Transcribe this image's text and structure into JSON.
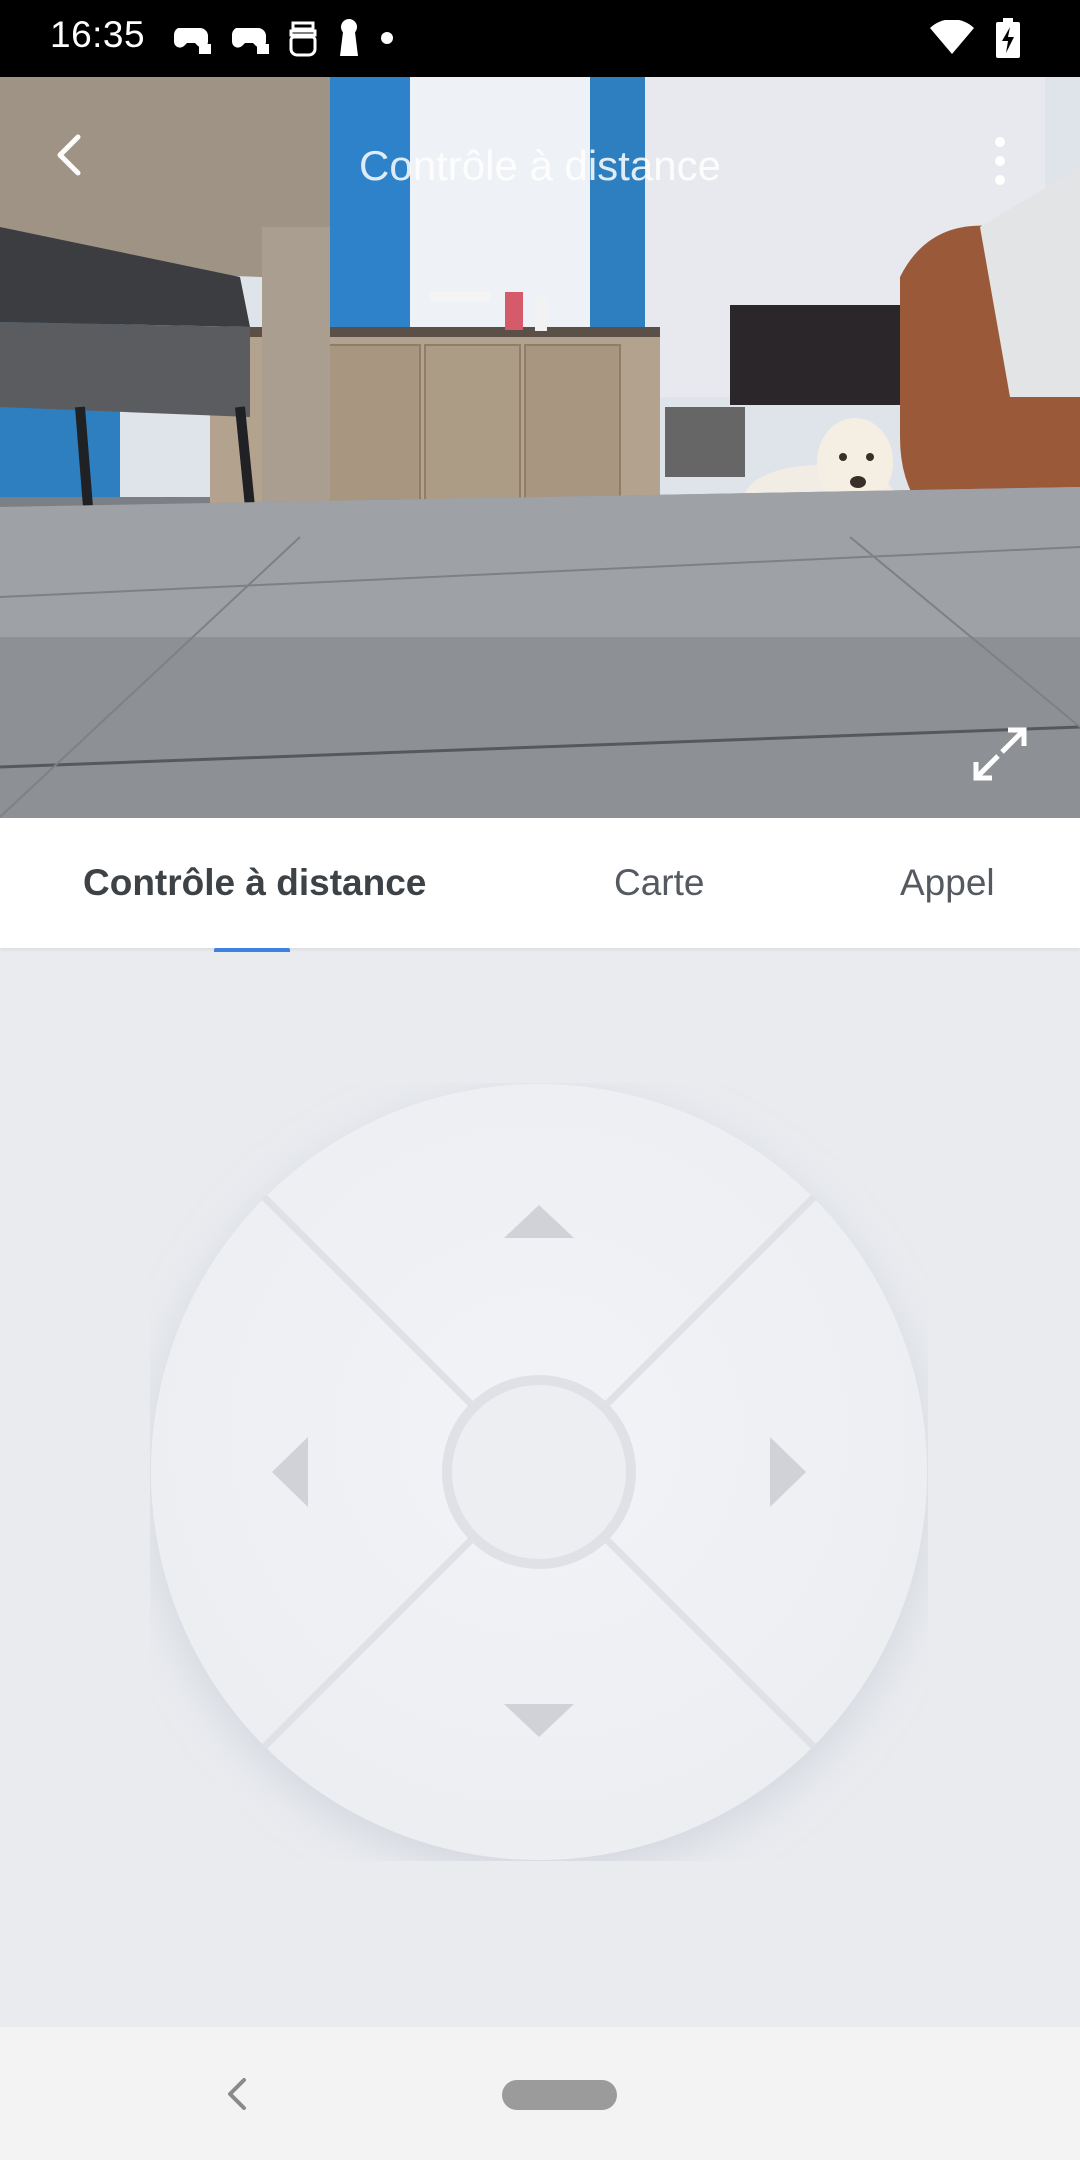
{
  "status_bar": {
    "time": "16:35",
    "left_icons": [
      "game-controller-icon",
      "game-controller-icon",
      "chat-bot-icon",
      "keyhole-icon",
      "dot-icon"
    ],
    "right_icons": [
      "wifi-icon",
      "battery-charging-icon"
    ]
  },
  "header": {
    "title": "Contrôle à distance",
    "back_icon": "chevron-left-icon",
    "more_icon": "more-vertical-icon",
    "fullscreen_icon": "expand-icon"
  },
  "tabs": [
    {
      "label": "Contrôle à distance",
      "active": true
    },
    {
      "label": "Carte",
      "active": false
    },
    {
      "label": "Appel",
      "active": false
    }
  ],
  "dpad": {
    "up_icon": "arrow-up-icon",
    "down_icon": "arrow-down-icon",
    "left_icon": "arrow-left-icon",
    "right_icon": "arrow-right-icon",
    "center_icon": "center-button"
  },
  "colors": {
    "accent": "#3d82e0",
    "background": "#e9ebef",
    "pad": "#eeeff3"
  }
}
